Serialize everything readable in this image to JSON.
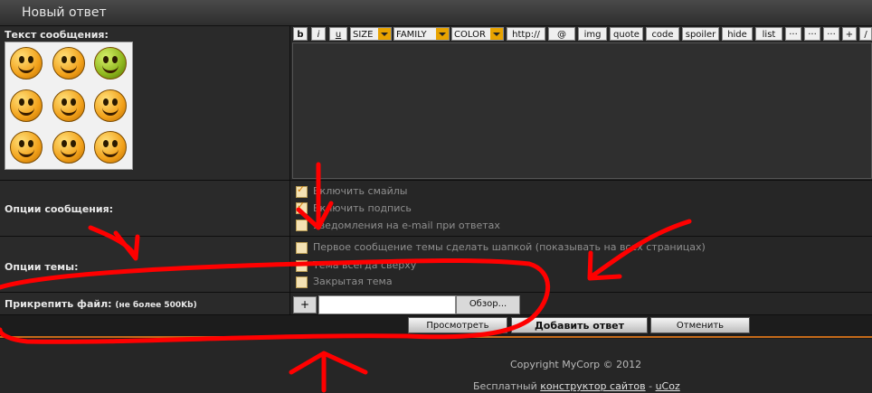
{
  "title": "Новый ответ",
  "labels": {
    "message_text": "Текст сообщения:",
    "message_options": "Опции сообщения:",
    "topic_options": "Опции темы:",
    "attach_file": "Прикрепить файл:",
    "attach_note": "(не более 500Kb)"
  },
  "toolbar": {
    "bold": "b",
    "italic": "i",
    "underline": "u",
    "size": "SIZE",
    "family": "FAMILY",
    "color": "COLOR",
    "url": "http://",
    "email": "@",
    "img": "img",
    "quote": "quote",
    "code": "code",
    "spoiler": "spoiler",
    "hide": "hide",
    "list": "list",
    "more1": "···",
    "more2": "···",
    "more3": "···",
    "plus": "+",
    "slash": "/"
  },
  "message_options": [
    {
      "label": "Включить смайлы",
      "checked": true
    },
    {
      "label": "Включить подпись",
      "checked": true
    },
    {
      "label": "Уведомления на e-mail при ответах",
      "checked": false
    }
  ],
  "topic_options": [
    {
      "label": "Первое сообщение темы сделать шапкой (показывать на всех страницах)",
      "checked": false
    },
    {
      "label": "Тема всегда сверху",
      "checked": false
    },
    {
      "label": "Закрытая тема",
      "checked": false
    }
  ],
  "file": {
    "add": "+",
    "value": "",
    "browse": "Обзор..."
  },
  "buttons": {
    "preview": "Просмотреть",
    "submit": "Добавить ответ",
    "cancel": "Отменить"
  },
  "footer": {
    "copyright": "Copyright MyCorp © 2012",
    "free": "Бесплатный ",
    "builder": "конструктор сайтов",
    "dash": " - ",
    "ucoz": "uCoz"
  },
  "colors": {
    "accent": "#e8a300",
    "annotation": "#ff0000",
    "divider": "#c46a1a"
  }
}
